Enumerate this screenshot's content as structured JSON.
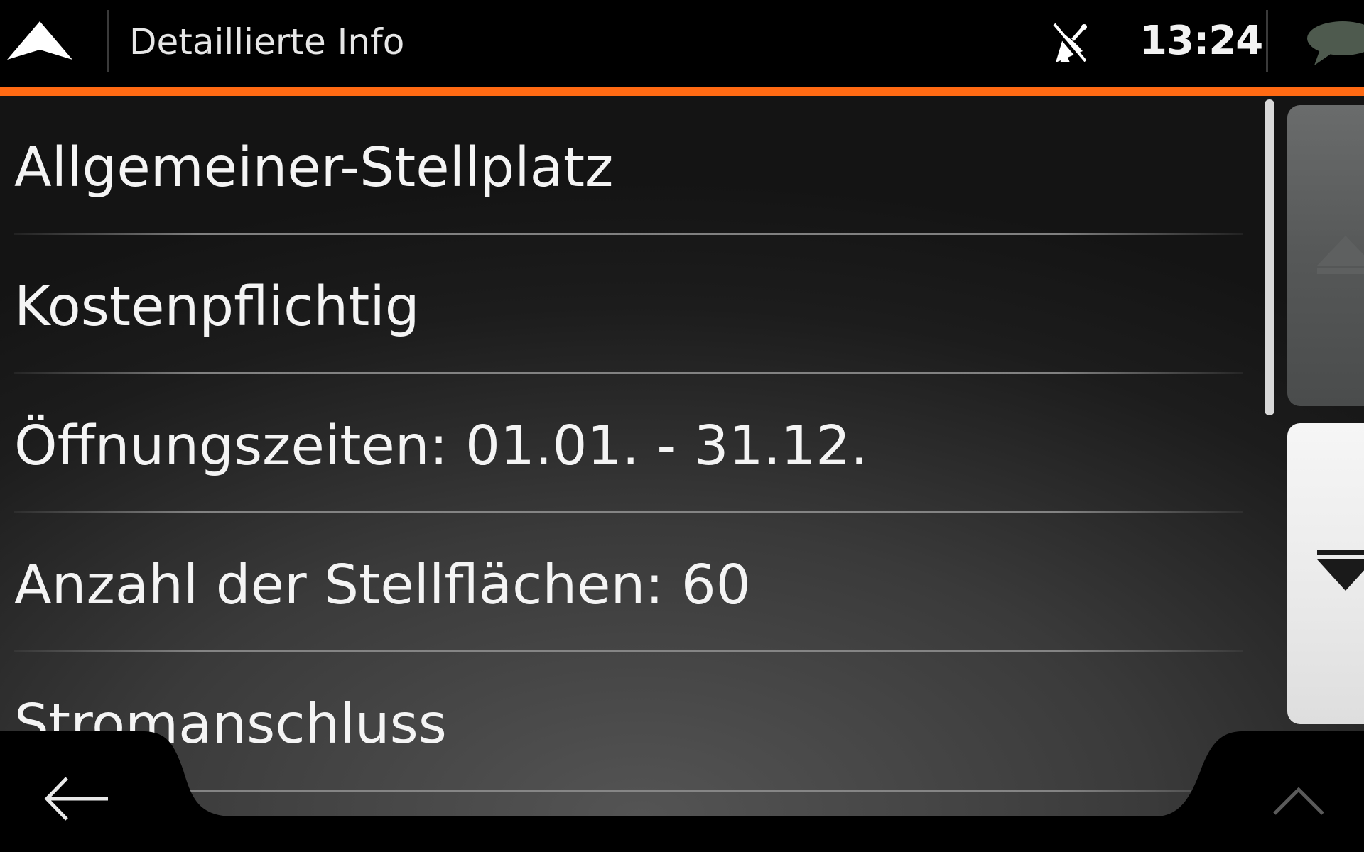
{
  "header": {
    "title": "Detaillierte Info",
    "clock": "13:24",
    "nav_icon": "navigation-arrow-icon",
    "gps_icon": "gps-satellite-off-icon",
    "message_icon": "speech-bubble-icon"
  },
  "list": {
    "items": [
      {
        "label": "Allgemeiner-Stellplatz"
      },
      {
        "label": "Kostenpflichtig"
      },
      {
        "label": "Öffnungszeiten: 01.01. - 31.12."
      },
      {
        "label": "Anzahl der Stellflächen: 60"
      },
      {
        "label": "Stromanschluss"
      }
    ]
  },
  "scroll": {
    "up_icon": "scroll-up-icon",
    "down_icon": "scroll-down-icon"
  },
  "footer": {
    "back_icon": "back-arrow-icon",
    "expand_icon": "chevron-up-icon"
  },
  "colors": {
    "accent": "#ff6a13",
    "header_bg": "#000000",
    "text": "#f4f4f4"
  }
}
